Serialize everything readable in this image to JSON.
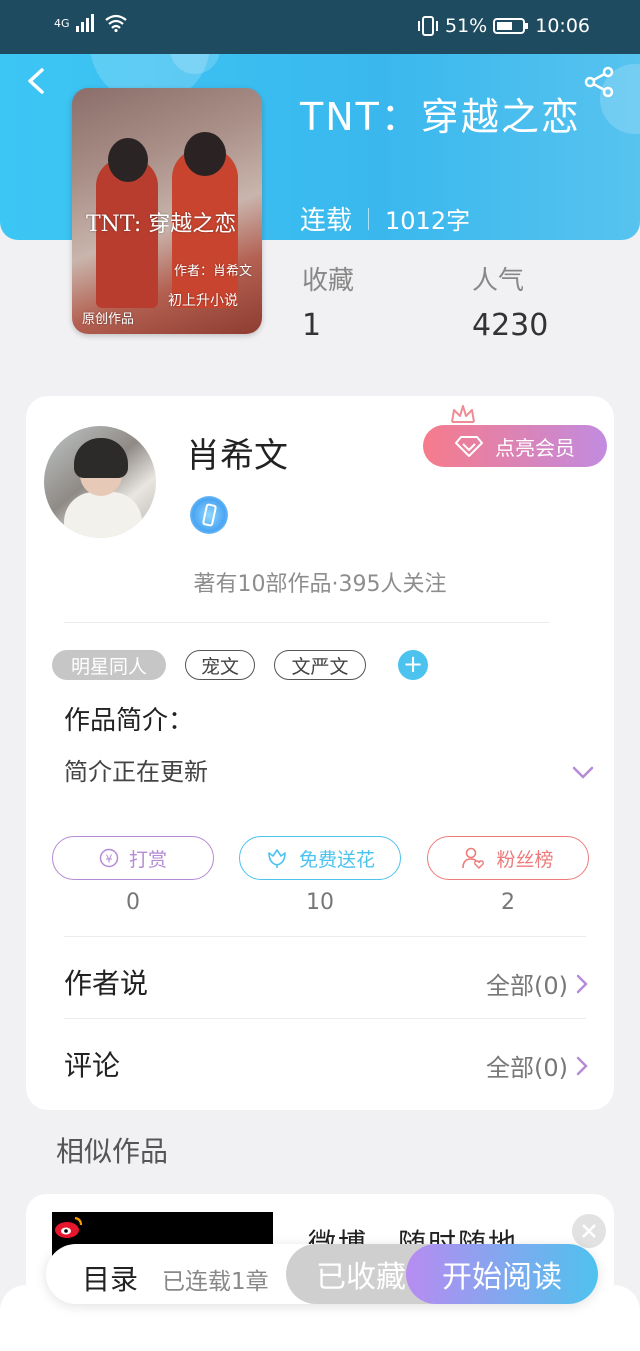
{
  "status_bar": {
    "network": "4G",
    "battery": "51%",
    "time": "10:06"
  },
  "book": {
    "title": "TNT：穿越之恋",
    "status": "连载",
    "word_count": "1012字",
    "cover": {
      "title_text": "TNT: 穿越之恋",
      "author_text": "作者：肖希文",
      "original_text": "原创作品",
      "subtitle_text": "初上升小说"
    },
    "stats": [
      {
        "label": "收藏",
        "value": "1"
      },
      {
        "label": "人气",
        "value": "4230"
      }
    ]
  },
  "author": {
    "name": "肖希文",
    "vip_label": "点亮会员",
    "works_info": "著有10部作品·395人关注"
  },
  "tags": [
    "明星同人",
    "宠文",
    "文严文"
  ],
  "intro": {
    "label": "作品简介：",
    "text": "简介正在更新"
  },
  "actions": [
    {
      "label": "打赏",
      "count": "0",
      "color": "#b58ad6"
    },
    {
      "label": "免费送花",
      "count": "10",
      "color": "#4cc3ef"
    },
    {
      "label": "粉丝榜",
      "count": "2",
      "color": "#ee7b7b"
    }
  ],
  "rows": [
    {
      "label": "作者说",
      "value": "全部(0)"
    },
    {
      "label": "评论",
      "value": "全部(0)"
    }
  ],
  "similar": {
    "heading": "相似作品",
    "ad_text": "微博，随时随地"
  },
  "bottom_bar": {
    "toc_label": "目录",
    "serialized": "已连载1章",
    "collected_label": "已收藏",
    "read_label": "开始阅读"
  },
  "colors": {
    "header": "#3ab8ee",
    "accent": "#4cc3ef",
    "vip_start": "#f67b8a",
    "vip_end": "#c28be0"
  }
}
